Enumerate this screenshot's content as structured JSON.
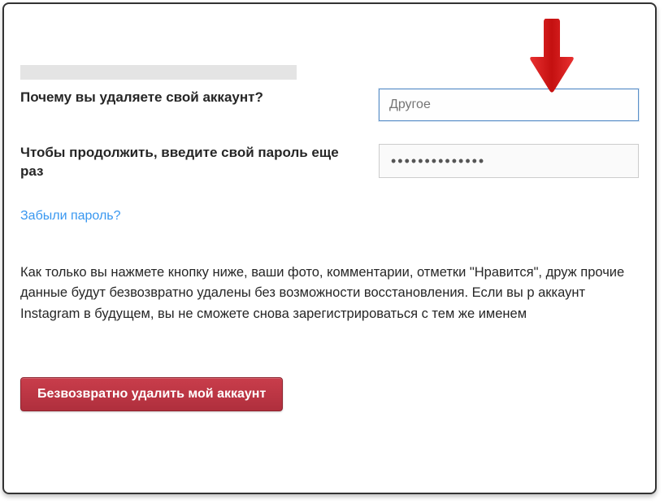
{
  "labels": {
    "reason": "Почему вы удаляете свой аккаунт?",
    "password": "Чтобы продолжить, введите свой пароль еще раз"
  },
  "fields": {
    "reason_value": "Другое",
    "password_mask": "••••••••••••••"
  },
  "links": {
    "forgot": "Забыли пароль?"
  },
  "warning_text": "Как только вы нажмете кнопку ниже, ваши фото, комментарии, отметки \"Нравится\", друж прочие данные будут безвозвратно удалены без возможности восстановления. Если вы р аккаунт Instagram в будущем, вы не сможете снова зарегистрироваться с тем же именем",
  "buttons": {
    "delete": "Безвозвратно удалить мой аккаунт"
  }
}
